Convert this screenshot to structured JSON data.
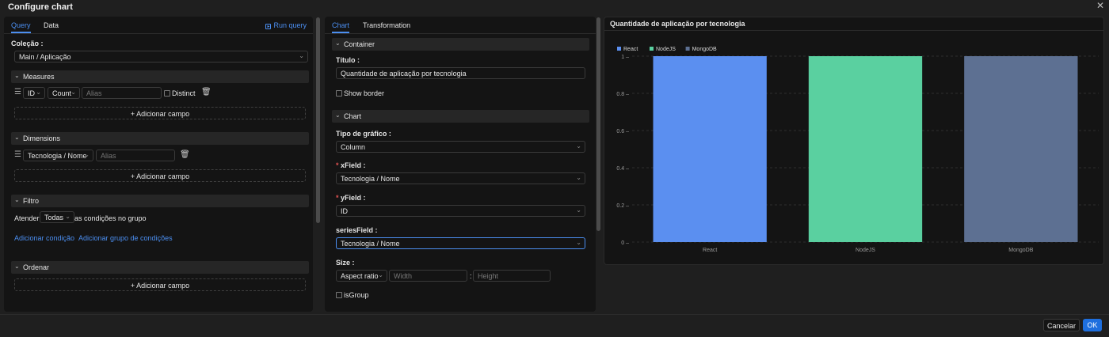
{
  "dialog": {
    "title": "Configure chart"
  },
  "query_panel": {
    "tabs": [
      "Query",
      "Data"
    ],
    "run_query": "Run query",
    "collection_label": "Coleção",
    "collection_value": "Main / Aplicação",
    "measures": {
      "title": "Measures",
      "field": "ID",
      "agg": "Count",
      "alias_placeholder": "Alias",
      "distinct": "Distinct",
      "add": "Adicionar campo"
    },
    "dimensions": {
      "title": "Dimensions",
      "field": "Tecnologia / Nome",
      "alias_placeholder": "Alias",
      "add": "Adicionar campo"
    },
    "filter": {
      "title": "Filtro",
      "prefix": "Atender",
      "mode": "Todas",
      "suffix": "as condições no grupo",
      "add_condition": "Adicionar condição",
      "add_group": "Adicionar grupo de condições"
    },
    "order": {
      "title": "Ordenar",
      "add": "Adicionar campo"
    }
  },
  "chart_panel": {
    "tabs": [
      "Chart",
      "Transformation"
    ],
    "container": {
      "title": "Container",
      "title_label": "Título",
      "title_value": "Quantidade de aplicação por tecnologia",
      "show_border": "Show border"
    },
    "chart": {
      "title": "Chart",
      "type_label": "Tipo de gráfico",
      "type_value": "Column",
      "xfield_label": "xField",
      "xfield_value": "Tecnologia / Nome",
      "yfield_label": "yField",
      "yfield_value": "ID",
      "series_label": "seriesField",
      "series_value": "Tecnologia / Nome",
      "size_label": "Size",
      "size_mode": "Aspect ratio",
      "width_placeholder": "Width",
      "height_placeholder": "Height",
      "colon": ":",
      "isgroup": "isGroup"
    }
  },
  "preview": {
    "title": "Quantidade de aplicação por tecnologia"
  },
  "chart_data": {
    "type": "bar",
    "categories": [
      "React",
      "NodeJS",
      "MongoDB"
    ],
    "values": [
      1,
      1,
      1
    ],
    "colors": [
      "#5b8ff0",
      "#5ad0a0",
      "#5d7092"
    ],
    "legend": [
      "React",
      "NodeJS",
      "MongoDB"
    ],
    "legend_position": "top-left",
    "ylim": [
      0,
      1
    ],
    "yticks": [
      0,
      0.2,
      0.4,
      0.6,
      0.8,
      1
    ],
    "ytick_labels": [
      "0 –",
      "0.2 –",
      "0.4 –",
      "0.6 –",
      "0.8 –",
      "1 –"
    ],
    "grid": true
  },
  "footer": {
    "cancel": "Cancelar",
    "ok": "OK"
  }
}
